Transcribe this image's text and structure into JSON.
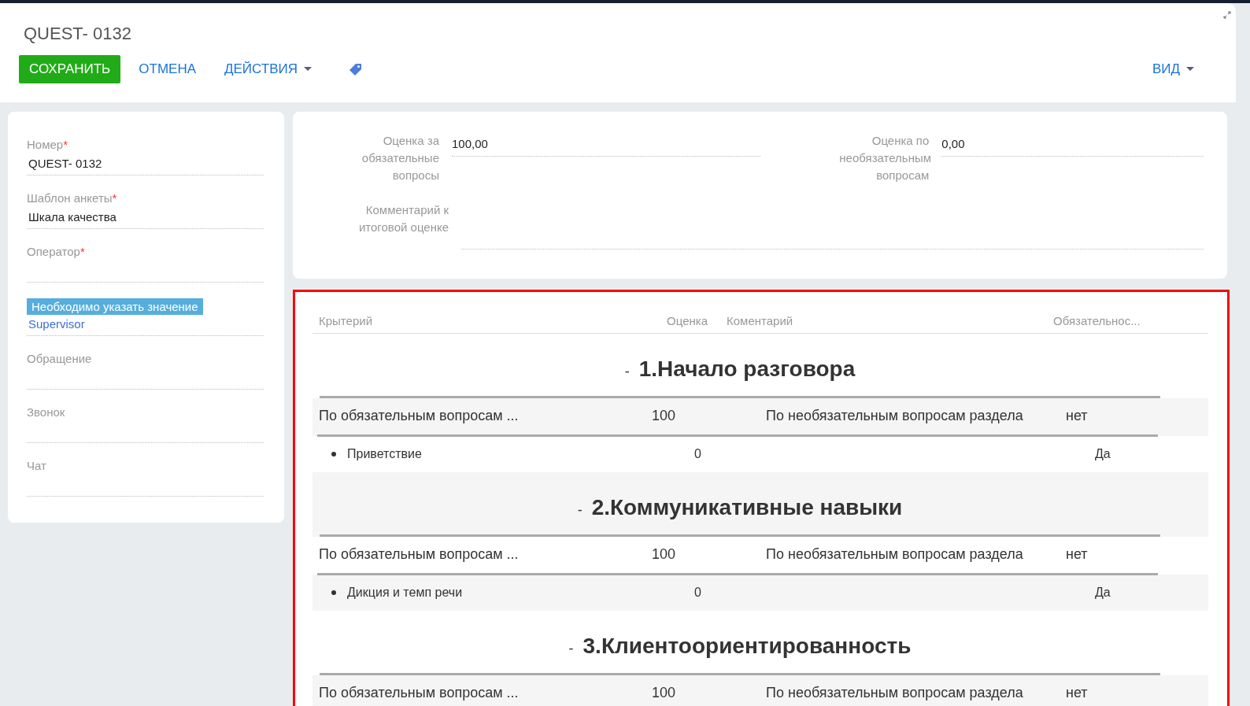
{
  "header": {
    "title": "QUEST- 0132",
    "buttons": [
      {
        "label": "СОХРАНИТЬ",
        "kind": "primary"
      },
      {
        "label": "ОТМЕНА",
        "kind": "link"
      },
      {
        "label": "ДЕЙСТВИЯ",
        "kind": "dropdown"
      },
      {
        "kind": "tag"
      }
    ],
    "view_button": {
      "label": "ВИД"
    }
  },
  "left_fields": [
    {
      "label": "Номер",
      "required_mark": "*",
      "value": "QUEST- 0132",
      "link": false
    },
    {
      "label": "Шаблон анкеты",
      "required_mark": "*",
      "value": "Шкала качества",
      "link": false
    },
    {
      "label": "Оператор",
      "required_mark": "*"
    },
    {
      "tooltip": "Необходимо указать значение",
      "value": "Supervisor",
      "link": true
    },
    {
      "label": "Обращение"
    },
    {
      "label": "Звонок"
    },
    {
      "label": "Чат"
    }
  ],
  "scores": [
    {
      "label": "Оценка за обязательные вопросы",
      "value": "100,00"
    },
    {
      "label": "Оценка по необязательным вопросам",
      "value": "0,00"
    }
  ],
  "final_comment": {
    "label": "Комментарий к итоговой оценке"
  },
  "table": {
    "highlighted": true,
    "columns": [
      "Крытерий",
      "Оценка",
      "Коментарий",
      "Обязательнос..."
    ],
    "sections": [
      {
        "toggle": "-",
        "title": "1.Начало разговора",
        "summary": [
          "По обязательным вопросам ...",
          "100",
          "По необязательным вопросам раздела",
          "нет"
        ],
        "items": [
          {
            "name": "Приветствие",
            "score": "0",
            "required": "Да"
          }
        ]
      },
      {
        "toggle": "-",
        "title": "2.Коммуникативные навыки",
        "summary": [
          "По обязательным вопросам ...",
          "100",
          "По необязательным вопросам раздела",
          "нет"
        ],
        "items": [
          {
            "name": "Дикция и темп речи",
            "score": "0",
            "required": "Да"
          }
        ]
      },
      {
        "toggle": "-",
        "title": "3.Клиентоориентированность",
        "summary": [
          "По обязательным вопросам ...",
          "100",
          "По необязательным вопросам раздела",
          "нет"
        ]
      }
    ]
  }
}
